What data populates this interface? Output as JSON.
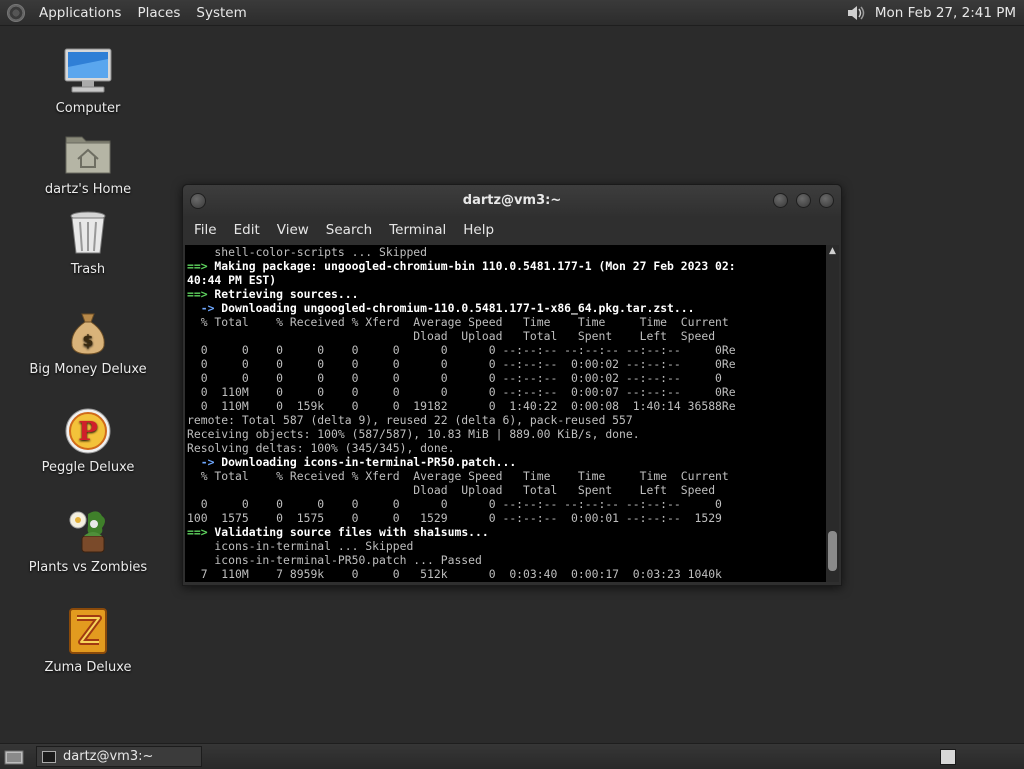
{
  "top_panel": {
    "menus": [
      "Applications",
      "Places",
      "System"
    ],
    "clock": "Mon Feb 27,  2:41 PM",
    "icons": {
      "logo": "distro-logo-icon",
      "volume": "speaker-icon"
    }
  },
  "desktop_icons": [
    {
      "label": "Computer",
      "icon": "computer-icon"
    },
    {
      "label": "dartz's Home",
      "icon": "home-folder-icon"
    },
    {
      "label": "Trash",
      "icon": "trash-icon"
    },
    {
      "label": "Big Money Deluxe",
      "icon": "money-bag-icon"
    },
    {
      "label": "Peggle Deluxe",
      "icon": "peggle-icon"
    },
    {
      "label": "Plants vs Zombies",
      "icon": "plants-vs-zombies-icon"
    },
    {
      "label": "Zuma Deluxe",
      "icon": "zuma-icon"
    }
  ],
  "terminal": {
    "title": "dartz@vm3:~",
    "menu": [
      "File",
      "Edit",
      "View",
      "Search",
      "Terminal",
      "Help"
    ],
    "lines": [
      {
        "parts": [
          {
            "c": "n",
            "t": "    shell-color-scripts ... Skipped"
          }
        ]
      },
      {
        "parts": [
          {
            "c": "g",
            "t": "==>"
          },
          {
            "c": "w",
            "t": " Making package: ungoogled-chromium-bin 110.0.5481.177-1 (Mon 27 Feb 2023 02:"
          }
        ]
      },
      {
        "parts": [
          {
            "c": "w",
            "t": "40:44 PM EST)"
          }
        ]
      },
      {
        "parts": [
          {
            "c": "g",
            "t": "==>"
          },
          {
            "c": "w",
            "t": " Retrieving sources..."
          }
        ]
      },
      {
        "parts": [
          {
            "c": "b",
            "t": "  ->"
          },
          {
            "c": "w",
            "t": " Downloading ungoogled-chromium-110.0.5481.177-1-x86_64.pkg.tar.zst..."
          }
        ]
      },
      {
        "parts": [
          {
            "c": "n",
            "t": "  % Total    % Received % Xferd  Average Speed   Time    Time     Time  Current"
          }
        ]
      },
      {
        "parts": [
          {
            "c": "n",
            "t": "                                 Dload  Upload   Total   Spent    Left  Speed"
          }
        ]
      },
      {
        "parts": [
          {
            "c": "n",
            "t": "  0     0    0     0    0     0      0      0 --:--:-- --:--:-- --:--:--     0Re"
          }
        ]
      },
      {
        "parts": [
          {
            "c": "n",
            "t": "  0     0    0     0    0     0      0      0 --:--:--  0:00:02 --:--:--     0Re"
          }
        ]
      },
      {
        "parts": [
          {
            "c": "n",
            "t": "  0     0    0     0    0     0      0      0 --:--:--  0:00:02 --:--:--     0"
          }
        ]
      },
      {
        "parts": [
          {
            "c": "n",
            "t": "  0  110M    0     0    0     0      0      0 --:--:--  0:00:07 --:--:--     0Re"
          }
        ]
      },
      {
        "parts": [
          {
            "c": "n",
            "t": "  0  110M    0  159k    0     0  19182      0  1:40:22  0:00:08  1:40:14 36588Re"
          }
        ]
      },
      {
        "parts": [
          {
            "c": "n",
            "t": "remote: Total 587 (delta 9), reused 22 (delta 6), pack-reused 557"
          }
        ]
      },
      {
        "parts": [
          {
            "c": "n",
            "t": "Receiving objects: 100% (587/587), 10.83 MiB | 889.00 KiB/s, done."
          }
        ]
      },
      {
        "parts": [
          {
            "c": "n",
            "t": "Resolving deltas: 100% (345/345), done."
          }
        ]
      },
      {
        "parts": [
          {
            "c": "b",
            "t": "  ->"
          },
          {
            "c": "w",
            "t": " Downloading icons-in-terminal-PR50.patch..."
          }
        ]
      },
      {
        "parts": [
          {
            "c": "n",
            "t": "  % Total    % Received % Xferd  Average Speed   Time    Time     Time  Current"
          }
        ]
      },
      {
        "parts": [
          {
            "c": "n",
            "t": "                                 Dload  Upload   Total   Spent    Left  Speed"
          }
        ]
      },
      {
        "parts": [
          {
            "c": "n",
            "t": "  0     0    0     0    0     0      0      0 --:--:-- --:--:-- --:--:--     0"
          }
        ]
      },
      {
        "parts": [
          {
            "c": "n",
            "t": "100  1575    0  1575    0     0   1529      0 --:--:--  0:00:01 --:--:--  1529"
          }
        ]
      },
      {
        "parts": [
          {
            "c": "g",
            "t": "==>"
          },
          {
            "c": "w",
            "t": " Validating source files with sha1sums..."
          }
        ]
      },
      {
        "parts": [
          {
            "c": "n",
            "t": "    icons-in-terminal ... Skipped"
          }
        ]
      },
      {
        "parts": [
          {
            "c": "n",
            "t": "    icons-in-terminal-PR50.patch ... Passed"
          }
        ]
      },
      {
        "parts": [
          {
            "c": "n",
            "t": "  7  110M    7 8959k    0     0   512k      0  0:03:40  0:00:17  0:03:23 1040k"
          }
        ]
      }
    ]
  },
  "taskbar": {
    "task": "dartz@vm3:~",
    "icons": {
      "show_desktop": "show-desktop-icon",
      "task": "terminal-icon",
      "workspace": "workspace-switcher-icon"
    }
  },
  "colors": {
    "prompt_green": "#5fd35f",
    "arrow_blue": "#6fa8ff",
    "terminal_bg": "#000000"
  }
}
